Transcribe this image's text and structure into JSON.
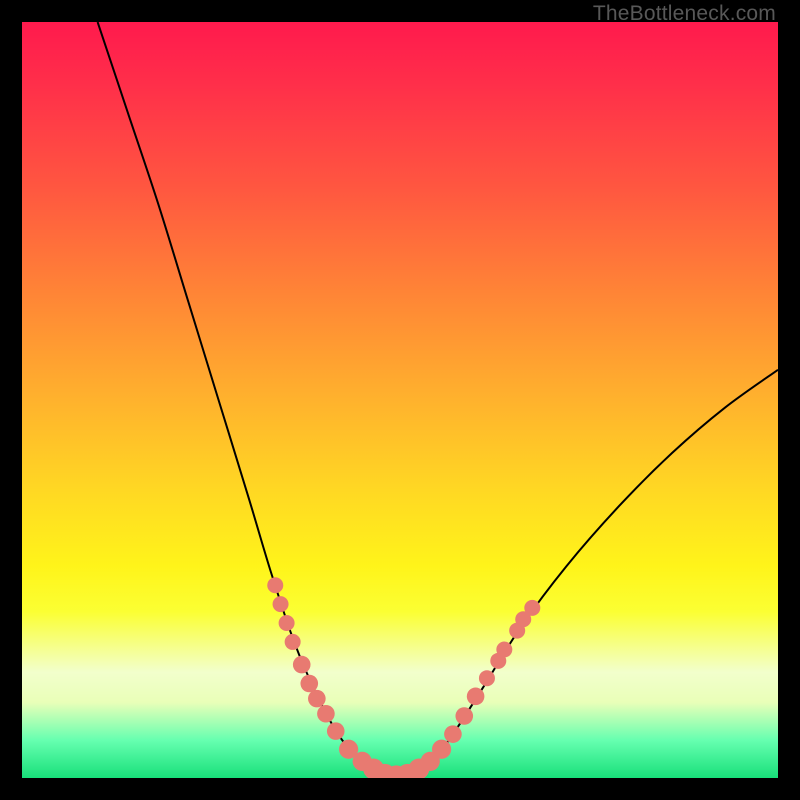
{
  "watermark": "TheBottleneck.com",
  "chart_data": {
    "type": "line",
    "title": "",
    "xlabel": "",
    "ylabel": "",
    "xlim": [
      0,
      100
    ],
    "ylim": [
      0,
      100
    ],
    "grid": false,
    "series": [
      {
        "name": "curve",
        "points": [
          {
            "x": 10,
            "y": 100
          },
          {
            "x": 14,
            "y": 88
          },
          {
            "x": 18,
            "y": 76
          },
          {
            "x": 22,
            "y": 63
          },
          {
            "x": 26,
            "y": 50
          },
          {
            "x": 30,
            "y": 37
          },
          {
            "x": 33,
            "y": 27
          },
          {
            "x": 36,
            "y": 18
          },
          {
            "x": 39,
            "y": 11
          },
          {
            "x": 42,
            "y": 5.5
          },
          {
            "x": 45,
            "y": 2.2
          },
          {
            "x": 48,
            "y": 0.6
          },
          {
            "x": 51,
            "y": 0.6
          },
          {
            "x": 54,
            "y": 2.0
          },
          {
            "x": 57,
            "y": 5.8
          },
          {
            "x": 61,
            "y": 12
          },
          {
            "x": 66,
            "y": 20
          },
          {
            "x": 72,
            "y": 28
          },
          {
            "x": 79,
            "y": 36
          },
          {
            "x": 86,
            "y": 43
          },
          {
            "x": 93,
            "y": 49
          },
          {
            "x": 100,
            "y": 54
          }
        ]
      }
    ],
    "highlight_points": [
      {
        "x": 33.5,
        "y": 25.5,
        "r": 1.0
      },
      {
        "x": 34.2,
        "y": 23.0,
        "r": 1.0
      },
      {
        "x": 35.0,
        "y": 20.5,
        "r": 1.0
      },
      {
        "x": 35.8,
        "y": 18.0,
        "r": 1.0
      },
      {
        "x": 37.0,
        "y": 15.0,
        "r": 1.1
      },
      {
        "x": 38.0,
        "y": 12.5,
        "r": 1.1
      },
      {
        "x": 39.0,
        "y": 10.5,
        "r": 1.1
      },
      {
        "x": 40.2,
        "y": 8.5,
        "r": 1.1
      },
      {
        "x": 41.5,
        "y": 6.2,
        "r": 1.1
      },
      {
        "x": 43.2,
        "y": 3.8,
        "r": 1.2
      },
      {
        "x": 45.0,
        "y": 2.2,
        "r": 1.2
      },
      {
        "x": 46.5,
        "y": 1.2,
        "r": 1.3
      },
      {
        "x": 48.0,
        "y": 0.5,
        "r": 1.3
      },
      {
        "x": 49.5,
        "y": 0.3,
        "r": 1.3
      },
      {
        "x": 51.0,
        "y": 0.5,
        "r": 1.3
      },
      {
        "x": 52.5,
        "y": 1.2,
        "r": 1.3
      },
      {
        "x": 54.0,
        "y": 2.2,
        "r": 1.2
      },
      {
        "x": 55.5,
        "y": 3.8,
        "r": 1.2
      },
      {
        "x": 57.0,
        "y": 5.8,
        "r": 1.1
      },
      {
        "x": 58.5,
        "y": 8.2,
        "r": 1.1
      },
      {
        "x": 60.0,
        "y": 10.8,
        "r": 1.1
      },
      {
        "x": 61.5,
        "y": 13.2,
        "r": 1.0
      },
      {
        "x": 63.0,
        "y": 15.5,
        "r": 1.0
      },
      {
        "x": 63.8,
        "y": 17.0,
        "r": 1.0
      },
      {
        "x": 65.5,
        "y": 19.5,
        "r": 1.0
      },
      {
        "x": 66.3,
        "y": 21.0,
        "r": 1.0
      },
      {
        "x": 67.5,
        "y": 22.5,
        "r": 1.0
      }
    ]
  }
}
